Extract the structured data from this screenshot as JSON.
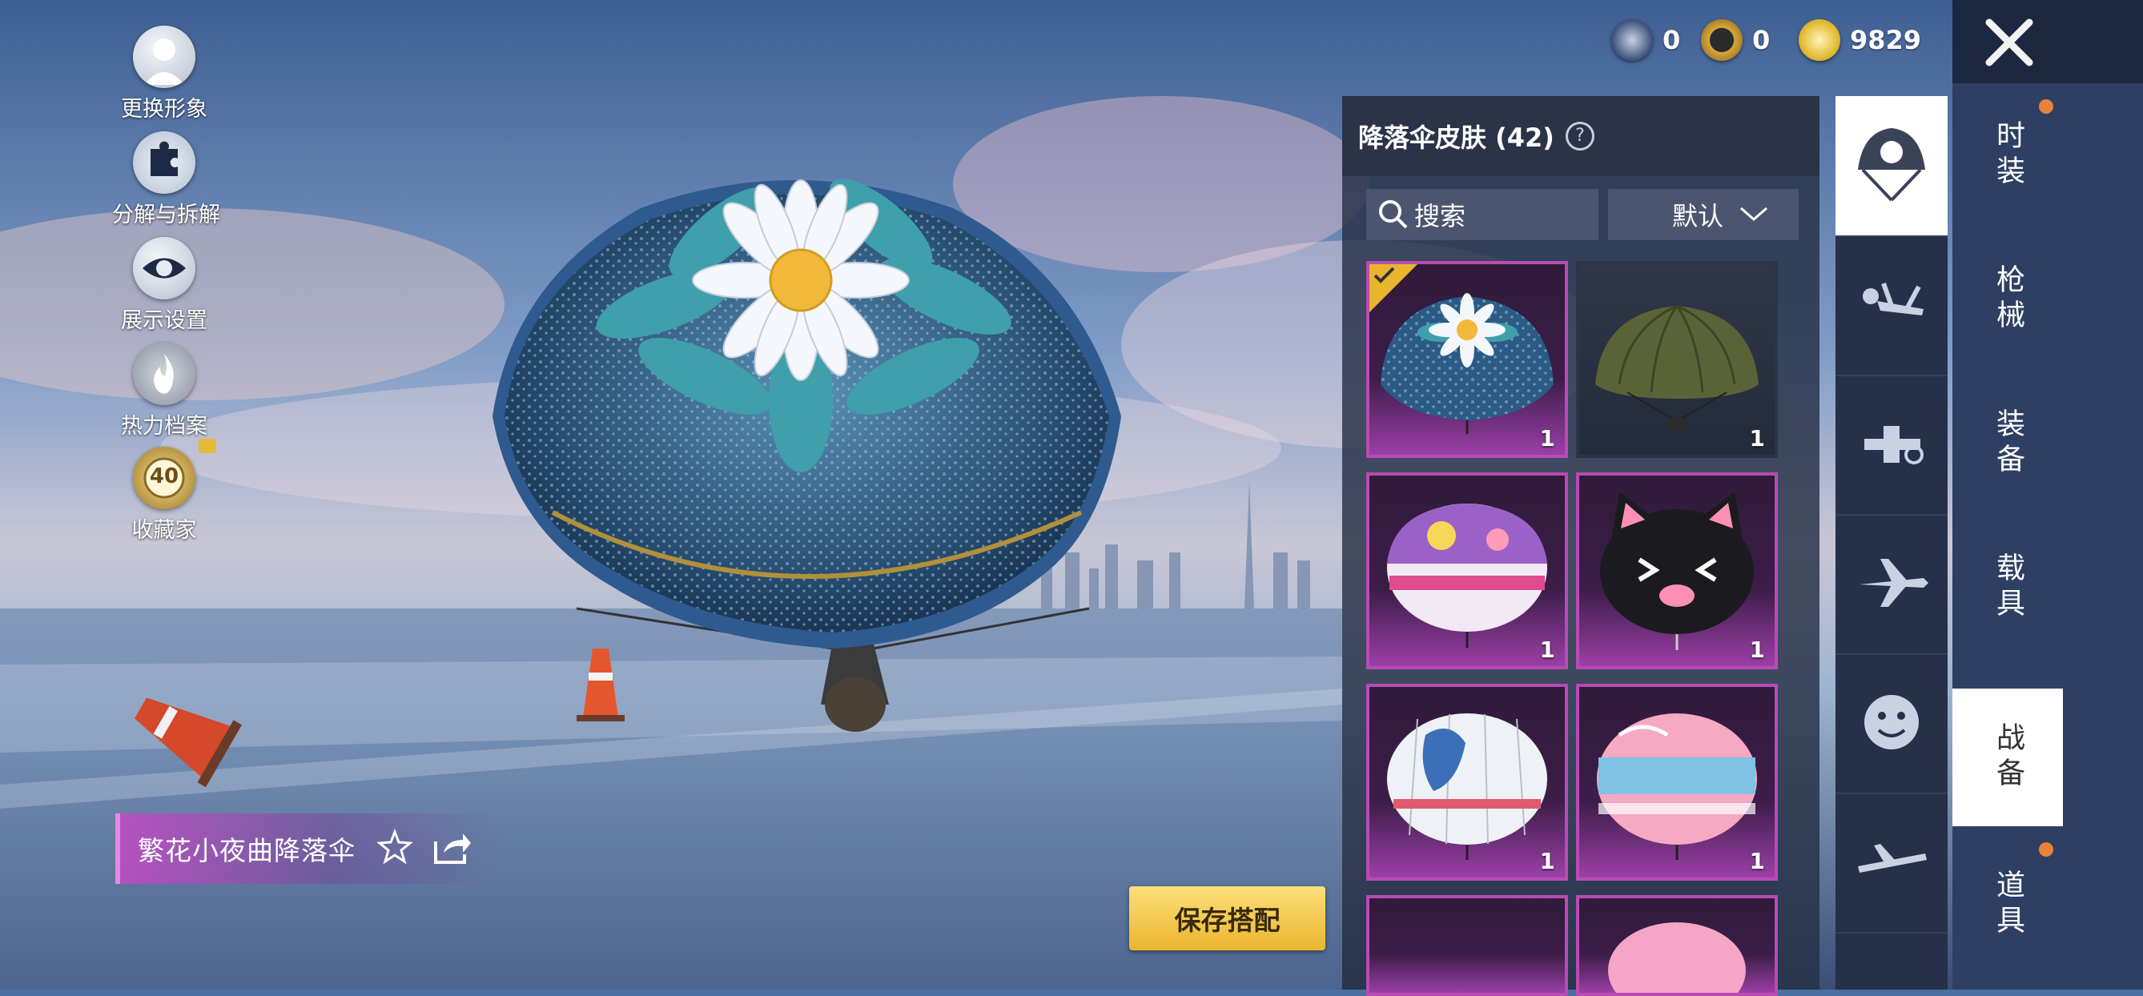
{
  "tools": [
    {
      "label": "更换形象",
      "icon": "avatar-icon"
    },
    {
      "label": "分解与拆解",
      "icon": "puzzle-icon"
    },
    {
      "label": "展示设置",
      "icon": "eye-icon"
    },
    {
      "label": "热力档案",
      "icon": "flame-icon"
    },
    {
      "label": "收藏家",
      "icon": "collector-badge-icon",
      "badge": "40"
    }
  ],
  "currencies": [
    {
      "icon": "k-coin-icon",
      "value": "0"
    },
    {
      "icon": "a-coin-icon",
      "value": "0"
    },
    {
      "icon": "gold-coin-icon",
      "value": "9829"
    }
  ],
  "item": {
    "name": "繁花小夜曲降落伞"
  },
  "save_label": "保存搭配",
  "panel": {
    "title": "降落伞皮肤 (42)",
    "help": "?",
    "search_placeholder": "搜索",
    "sort_label": "默认",
    "items": [
      {
        "name": "flower-parachute",
        "count": "1",
        "equipped": true
      },
      {
        "name": "olive-parachute",
        "count": "1"
      },
      {
        "name": "purple-parachute",
        "count": "1"
      },
      {
        "name": "cat-parachute",
        "count": "1"
      },
      {
        "name": "anime-parachute",
        "count": "1"
      },
      {
        "name": "macaroon-parachute",
        "count": "1"
      }
    ]
  },
  "sub_tabs": [
    "parachute-icon",
    "skydiver-icon",
    "plane-vehicle-icon",
    "airplane-icon",
    "emote-icon",
    "glider-icon"
  ],
  "main_tabs": [
    "时装",
    "枪械",
    "装备",
    "载具",
    "战备",
    "道具"
  ],
  "colors": {
    "rarity_purple": "#b94bb3",
    "accent_gold": "#e9b52c",
    "notify_orange": "#e8833a"
  }
}
